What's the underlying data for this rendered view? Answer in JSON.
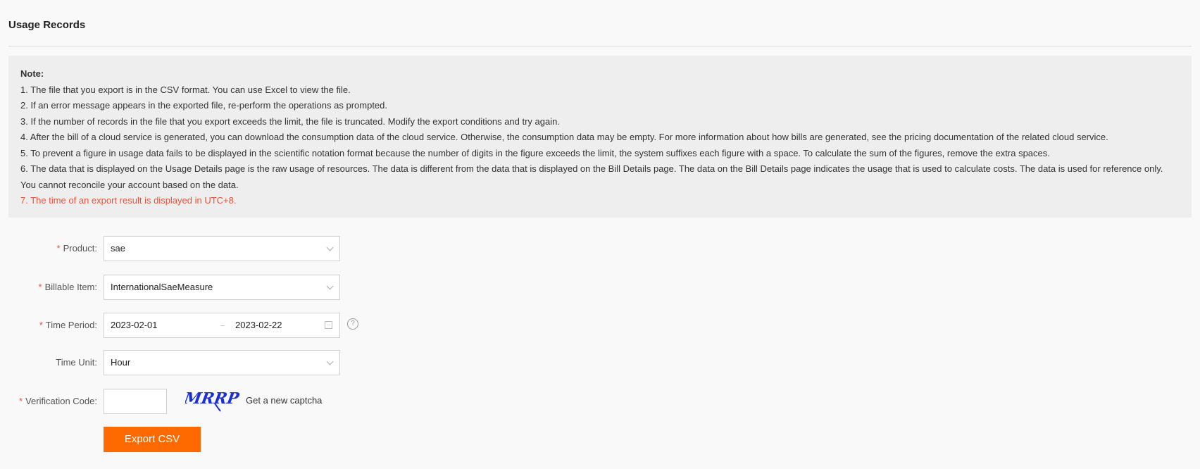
{
  "page": {
    "title": "Usage Records"
  },
  "note": {
    "title": "Note:",
    "lines": [
      "1. The file that you export is in the CSV format. You can use Excel to view the file.",
      "2. If an error message appears in the exported file, re-perform the operations as prompted.",
      "3. If the number of records in the file that you export exceeds the limit, the file is truncated. Modify the export conditions and try again.",
      "4. After the bill of a cloud service is generated, you can download the consumption data of the cloud service. Otherwise, the consumption data may be empty. For more information about how bills are generated, see the pricing documentation of the related cloud service.",
      "5. To prevent a figure in usage data fails to be displayed in the scientific notation format because the number of digits in the figure exceeds the limit, the system suffixes each figure with a space. To calculate the sum of the figures, remove the extra spaces.",
      "6. The data that is displayed on the Usage Details page is the raw usage of resources. The data is different from the data that is displayed on the Bill Details page. The data on the Bill Details page indicates the usage that is used to calculate costs. The data is used for reference only. You cannot reconcile your account based on the data.",
      "7. The time of an export result is displayed in UTC+8."
    ],
    "highlight_color": "#e5533c"
  },
  "form": {
    "required_mark": "*",
    "product": {
      "label": "Product:",
      "value": "sae"
    },
    "billable_item": {
      "label": "Billable Item:",
      "value": "InternationalSaeMeasure"
    },
    "time_period": {
      "label": "Time Period:",
      "start": "2023-02-01",
      "end": "2023-02-22",
      "help": "?"
    },
    "time_unit": {
      "label": "Time Unit:",
      "value": "Hour"
    },
    "verification": {
      "label": "Verification Code:",
      "value": "",
      "captcha_text": "MRRP",
      "refresh_link": "Get a new captcha"
    },
    "export_button": "Export CSV"
  },
  "colors": {
    "accent": "#ff6a00",
    "required": "#e5533c",
    "captcha": "#1a2fd8"
  }
}
